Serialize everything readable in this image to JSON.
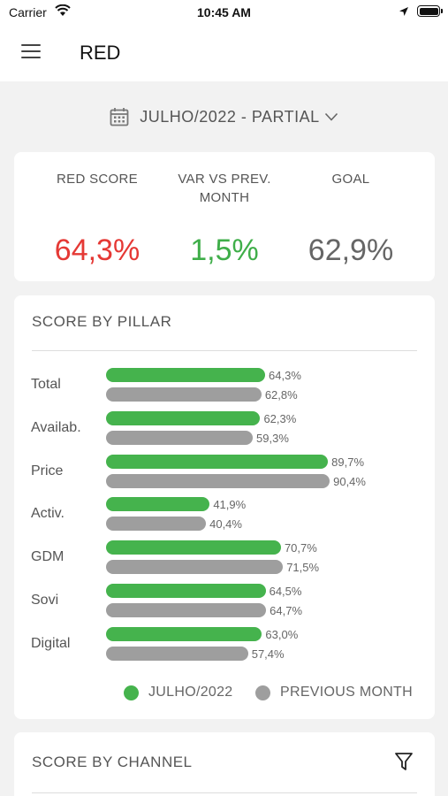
{
  "status_bar": {
    "carrier": "Carrier",
    "time": "10:45 AM"
  },
  "header": {
    "title": "RED"
  },
  "period": {
    "label": "JULHO/2022 - PARTIAL"
  },
  "kpis": [
    {
      "label": "RED SCORE",
      "value": "64,3%",
      "color": "#e53935"
    },
    {
      "label": "VAR VS PREV. MONTH",
      "value": "1,5%",
      "color": "#3fae49"
    },
    {
      "label": "GOAL",
      "value": "62,9%",
      "color": "#666666"
    }
  ],
  "pillar_card": {
    "title": "SCORE BY PILLAR",
    "legend": {
      "current": "JULHO/2022",
      "previous": "PREVIOUS MONTH"
    }
  },
  "chart_data": {
    "type": "bar",
    "orientation": "horizontal",
    "categories": [
      "Total",
      "Availab.",
      "Price",
      "Activ.",
      "GDM",
      "Sovi",
      "Digital"
    ],
    "series": [
      {
        "name": "JULHO/2022",
        "color": "#45b34d",
        "values": [
          64.3,
          62.3,
          89.7,
          41.9,
          70.7,
          64.5,
          63.0
        ],
        "labels": [
          "64,3%",
          "62,3%",
          "89,7%",
          "41,9%",
          "70,7%",
          "64,5%",
          "63,0%"
        ]
      },
      {
        "name": "PREVIOUS MONTH",
        "color": "#9e9e9e",
        "values": [
          62.8,
          59.3,
          90.4,
          40.4,
          71.5,
          64.7,
          57.4
        ],
        "labels": [
          "62,8%",
          "59,3%",
          "90,4%",
          "40,4%",
          "71,5%",
          "64,7%",
          "57,4%"
        ]
      }
    ],
    "grid": false,
    "legend_position": "bottom"
  },
  "channel_card": {
    "title": "SCORE BY CHANNEL"
  },
  "icons": {
    "menu": "hamburger-menu-icon",
    "calendar": "calendar-icon",
    "caret": "chevron-down-icon",
    "filter": "filter-icon",
    "wifi": "wifi-icon",
    "location": "location-arrow-icon",
    "battery": "battery-icon"
  }
}
